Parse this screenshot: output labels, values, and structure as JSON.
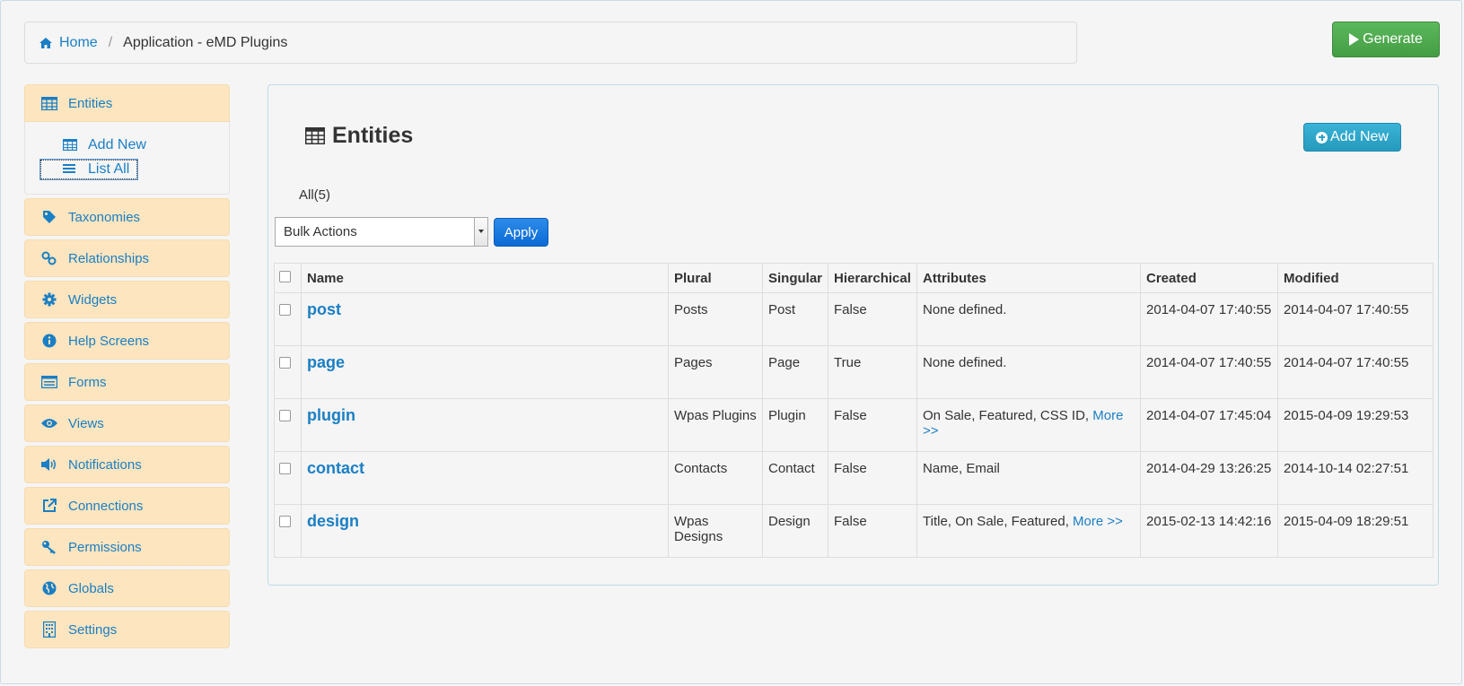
{
  "breadcrumb": {
    "home": "Home",
    "separator": "/",
    "current": "Application - eMD Plugins"
  },
  "generate_label": "Generate",
  "sidebar": {
    "entities": {
      "label": "Entities",
      "sub": [
        {
          "label": "Add New"
        },
        {
          "label": "List All"
        }
      ]
    },
    "items": [
      {
        "label": "Taxonomies",
        "icon": "tag-icon"
      },
      {
        "label": "Relationships",
        "icon": "link-icon"
      },
      {
        "label": "Widgets",
        "icon": "gear-icon"
      },
      {
        "label": "Help Screens",
        "icon": "info-icon"
      },
      {
        "label": "Forms",
        "icon": "form-icon"
      },
      {
        "label": "Views",
        "icon": "eye-icon"
      },
      {
        "label": "Notifications",
        "icon": "volume-icon"
      },
      {
        "label": "Connections",
        "icon": "external-link-icon"
      },
      {
        "label": "Permissions",
        "icon": "key-icon"
      },
      {
        "label": "Globals",
        "icon": "globe-icon"
      },
      {
        "label": "Settings",
        "icon": "building-icon"
      }
    ]
  },
  "main": {
    "title": "Entities",
    "add_new_label": "Add New",
    "filter_all": "All(5)",
    "bulk_actions": "Bulk Actions",
    "apply_label": "Apply",
    "columns": [
      "Name",
      "Plural",
      "Singular",
      "Hierarchical",
      "Attributes",
      "Created",
      "Modified"
    ],
    "rows": [
      {
        "name": "post",
        "plural": "Posts",
        "singular": "Post",
        "hierarchical": "False",
        "attributes": "None defined.",
        "more": "",
        "created": "2014-04-07 17:40:55",
        "modified": "2014-04-07 17:40:55"
      },
      {
        "name": "page",
        "plural": "Pages",
        "singular": "Page",
        "hierarchical": "True",
        "attributes": "None defined.",
        "more": "",
        "created": "2014-04-07 17:40:55",
        "modified": "2014-04-07 17:40:55"
      },
      {
        "name": "plugin",
        "plural": "Wpas Plugins",
        "singular": "Plugin",
        "hierarchical": "False",
        "attributes": "On Sale, Featured, CSS ID,",
        "more": "More >>",
        "created": "2014-04-07 17:45:04",
        "modified": "2015-04-09 19:29:53"
      },
      {
        "name": "contact",
        "plural": "Contacts",
        "singular": "Contact",
        "hierarchical": "False",
        "attributes": "Name, Email",
        "more": "",
        "created": "2014-04-29 13:26:25",
        "modified": "2014-10-14 02:27:51"
      },
      {
        "name": "design",
        "plural": "Wpas Designs",
        "singular": "Design",
        "hierarchical": "False",
        "attributes": "Title, On Sale, Featured,",
        "more": "More >>",
        "created": "2015-02-13 14:42:16",
        "modified": "2015-04-09 18:29:51"
      }
    ]
  }
}
